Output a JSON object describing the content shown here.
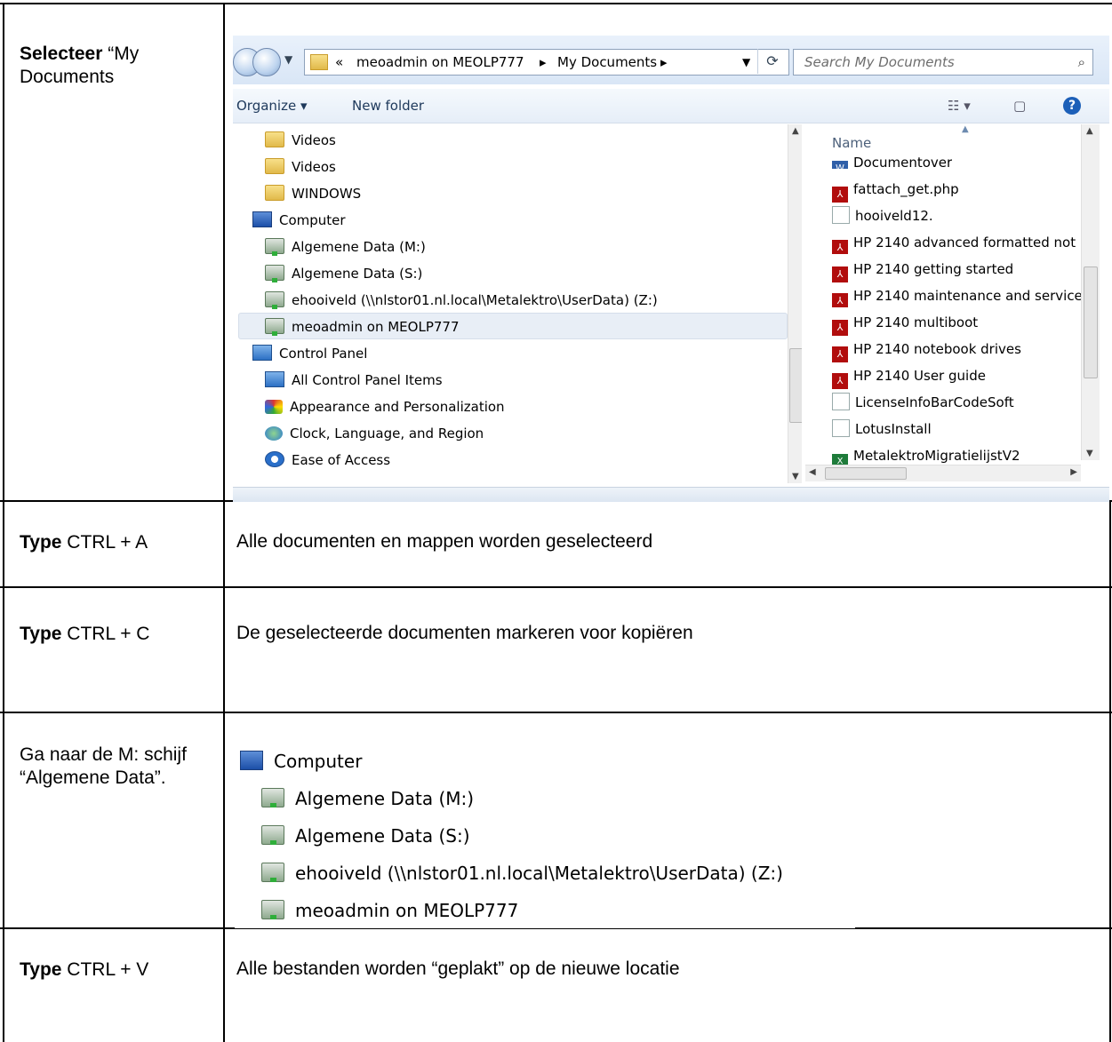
{
  "rows": [
    {
      "bold": "Selecteer",
      "text": " “My Documents",
      "right": ""
    },
    {
      "bold": "Type",
      "text": " CTRL + A",
      "right": "Alle documenten en mappen worden geselecteerd"
    },
    {
      "bold": "Type",
      "text": " CTRL + C",
      "right": "De geselecteerde documenten markeren voor kopiëren"
    },
    {
      "bold": "",
      "text": "Ga naar de M: schijf “Algemene Data”.",
      "right": ""
    },
    {
      "bold": "Type",
      "text": " CTRL + V",
      "right": "Alle bestanden worden “geplakt” op de nieuwe locatie"
    }
  ],
  "explorer": {
    "breadcrumb_prefix": "«",
    "breadcrumb_1": "meoadmin on MEOLP777",
    "breadcrumb_sep": "▸",
    "breadcrumb_2": "My Documents",
    "search_placeholder": "Search My Documents",
    "organize": "Organize ▾",
    "new_folder": "New folder",
    "nav_items": [
      {
        "label": "Videos",
        "icon": "folder-icon"
      },
      {
        "label": "Videos",
        "icon": "folder-icon"
      },
      {
        "label": "WINDOWS",
        "icon": "folder-icon"
      },
      {
        "label": "Computer",
        "icon": "computer-icon"
      },
      {
        "label": "Algemene Data (M:)",
        "icon": "network-drive-icon"
      },
      {
        "label": "Algemene Data (S:)",
        "icon": "network-drive-icon"
      },
      {
        "label": "ehooiveld (\\\\nlstor01.nl.local\\Metalektro\\UserData) (Z:)",
        "icon": "network-drive-icon"
      },
      {
        "label": "meoadmin on MEOLP777",
        "icon": "network-drive-icon"
      },
      {
        "label": "Control Panel",
        "icon": "control-panel-icon"
      },
      {
        "label": "All Control Panel Items",
        "icon": "control-panel-icon"
      },
      {
        "label": "Appearance and Personalization",
        "icon": "paint-icon"
      },
      {
        "label": "Clock, Language, and Region",
        "icon": "globe-icon"
      },
      {
        "label": "Ease of Access",
        "icon": "access-icon"
      }
    ],
    "name_header": "Name",
    "files": [
      {
        "label": "Documentover",
        "type": "doc"
      },
      {
        "label": "fattach_get.php",
        "type": "pdf"
      },
      {
        "label": "hooiveld12.",
        "type": "txt"
      },
      {
        "label": "HP 2140 advanced formatted not",
        "type": "pdf"
      },
      {
        "label": "HP 2140 getting started",
        "type": "pdf"
      },
      {
        "label": "HP 2140 maintenance and service",
        "type": "pdf"
      },
      {
        "label": "HP 2140 multiboot",
        "type": "pdf"
      },
      {
        "label": "HP 2140 notebook drives",
        "type": "pdf"
      },
      {
        "label": "HP 2140 User guide",
        "type": "pdf"
      },
      {
        "label": "LicenseInfoBarCodeSoft",
        "type": "txt"
      },
      {
        "label": "LotusInstall",
        "type": "txt"
      },
      {
        "label": "MetalektroMigratielijstV2",
        "type": "xls"
      }
    ]
  },
  "crop": {
    "items": [
      {
        "label": "Computer",
        "icon": "computer-icon"
      },
      {
        "label": "Algemene Data (M:)",
        "icon": "network-drive-icon"
      },
      {
        "label": "Algemene Data (S:)",
        "icon": "network-drive-icon"
      },
      {
        "label": "ehooiveld (\\\\nlstor01.nl.local\\Metalektro\\UserData) (Z:)",
        "icon": "network-drive-icon"
      },
      {
        "label": "meoadmin on MEOLP777",
        "icon": "network-drive-icon"
      }
    ]
  }
}
